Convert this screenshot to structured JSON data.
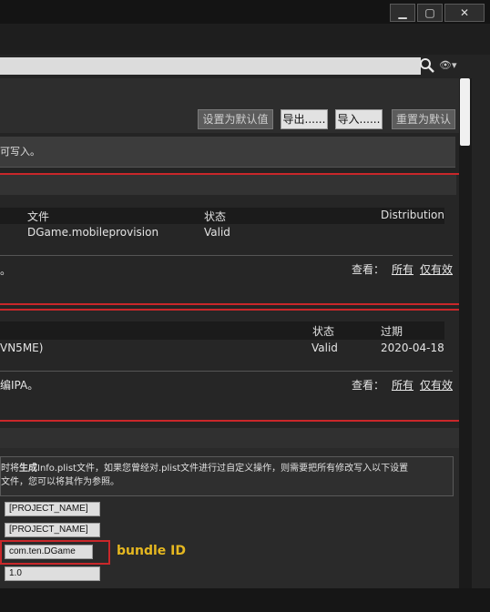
{
  "window": {
    "minimize_glyph": "▁",
    "maximize_glyph": "▢",
    "close_glyph": "✕"
  },
  "search": {
    "value": "",
    "icon": "search-icon",
    "view_icon": "eye-icon",
    "view_glyph": "👁▾"
  },
  "toolbar": {
    "set_default": "设置为默认值",
    "export": "导出......",
    "import": "导入......",
    "reset_default": "重置为默认"
  },
  "notice": "可写入。",
  "provisions": {
    "columns": [
      "文件",
      "状态",
      "Distribution"
    ],
    "row": {
      "file": "DGame.mobileprovision",
      "status": "Valid"
    },
    "footer_left": "。",
    "view_label": "查看：",
    "all": "所有",
    "valid_only": "仅有效"
  },
  "certificates": {
    "columns": [
      "状态",
      "过期"
    ],
    "row": {
      "name": "VN5ME)",
      "status": "Valid",
      "expiry": "2020-04-18"
    },
    "footer_left": "编IPA。",
    "view_label": "查看：",
    "all": "所有",
    "valid_only": "仅有效"
  },
  "plist": {
    "desc_line1_pre": "时将",
    "desc_line1_bold": "生成",
    "desc_line1_post": "Info.plist文件，如果您曾经对.plist文件进行过自定义操作，则需要把所有修改写入以下设置",
    "desc_line2": "文件，您可以将其作为参照。",
    "fields": [
      "[PROJECT_NAME]",
      "[PROJECT_NAME]",
      "com.ten.DGame",
      "1.0"
    ],
    "bundle_annotation": "bundle ID"
  },
  "colors": {
    "highlight": "#c9272a",
    "annotation": "#e6b820"
  }
}
